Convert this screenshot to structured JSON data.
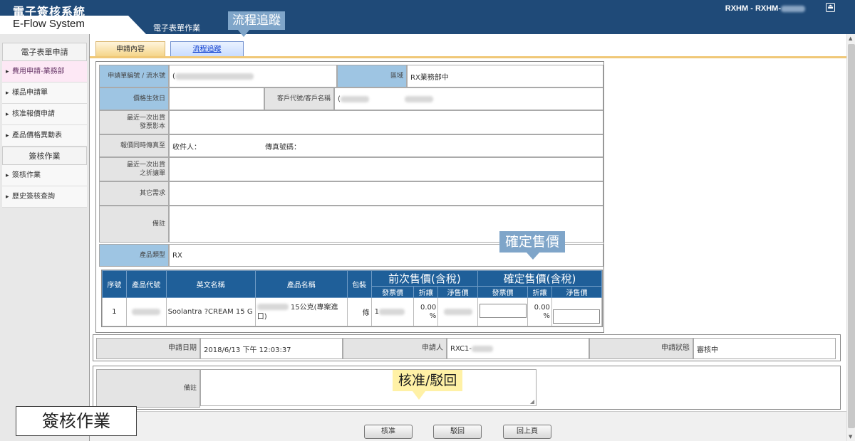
{
  "header": {
    "title": "電子簽核系統",
    "subtitle": "E-Flow System",
    "nav_item": "電子表單作業",
    "user": "RXHM - RXHM-",
    "logout_icon": "exit-icon"
  },
  "sidebar": {
    "section1": "電子表單申請",
    "items1": [
      "費用申請-業務部",
      "樣品申請單",
      "核准報價申請",
      "產品價格異動表"
    ],
    "section2": "簽核作業",
    "items2": [
      "簽核作業",
      "歷史簽核查詢"
    ]
  },
  "tabs": [
    "申請內容",
    "流程追蹤"
  ],
  "form": {
    "labels": {
      "app_no": "申請單編號 / 流水號",
      "region": "區域",
      "effective_date": "價格生效日",
      "customer": "客戶代號/客戶名稱",
      "last_invoice": "最近一次出貨\n發票影本",
      "quote_fax": "報價同時傳真至",
      "last_discount": "最近一次出貨\n之折讓單",
      "other": "其它需求",
      "remark": "備註",
      "product_type": "產品類型"
    },
    "values": {
      "region": "RX業務部中",
      "customer_prefix": "(",
      "app_no_prefix": "(",
      "receiver": "收件人：",
      "fax_no": "傳真號碼：",
      "product_type": "RX"
    }
  },
  "product_table": {
    "headers": [
      "序號",
      "產品代號",
      "英文名稱",
      "產品名稱",
      "包裝"
    ],
    "group1": "前次售價(含稅)",
    "group2": "確定售價(含稅)",
    "sub_headers": [
      "發票價",
      "折讓",
      "淨售價",
      "發票價",
      "折讓",
      "淨售價"
    ],
    "rows": [
      {
        "seq": "1",
        "en_name": "Soolantra ?CREAM 15 G",
        "name_suffix": " 15公克(專案進口)",
        "pack": "條",
        "prev_invoice_prefix": "1",
        "prev_discount": "0.00\n%",
        "new_discount": "0.00\n%"
      }
    ]
  },
  "applicant": {
    "date_label": "申請日期",
    "date_value": "2018/6/13 下午 12:03:37",
    "applicant_label": "申請人",
    "applicant_value": "RXC1-",
    "status_label": "申請狀態",
    "status_value": "審核中"
  },
  "remark_label": "備註",
  "buttons": {
    "approve": "核准",
    "reject": "駁回",
    "back": "回上頁"
  },
  "callouts": {
    "flow": "流程追蹤",
    "price": "確定售價",
    "approve_reject": "核准/駁回",
    "signing": "簽核作業"
  }
}
